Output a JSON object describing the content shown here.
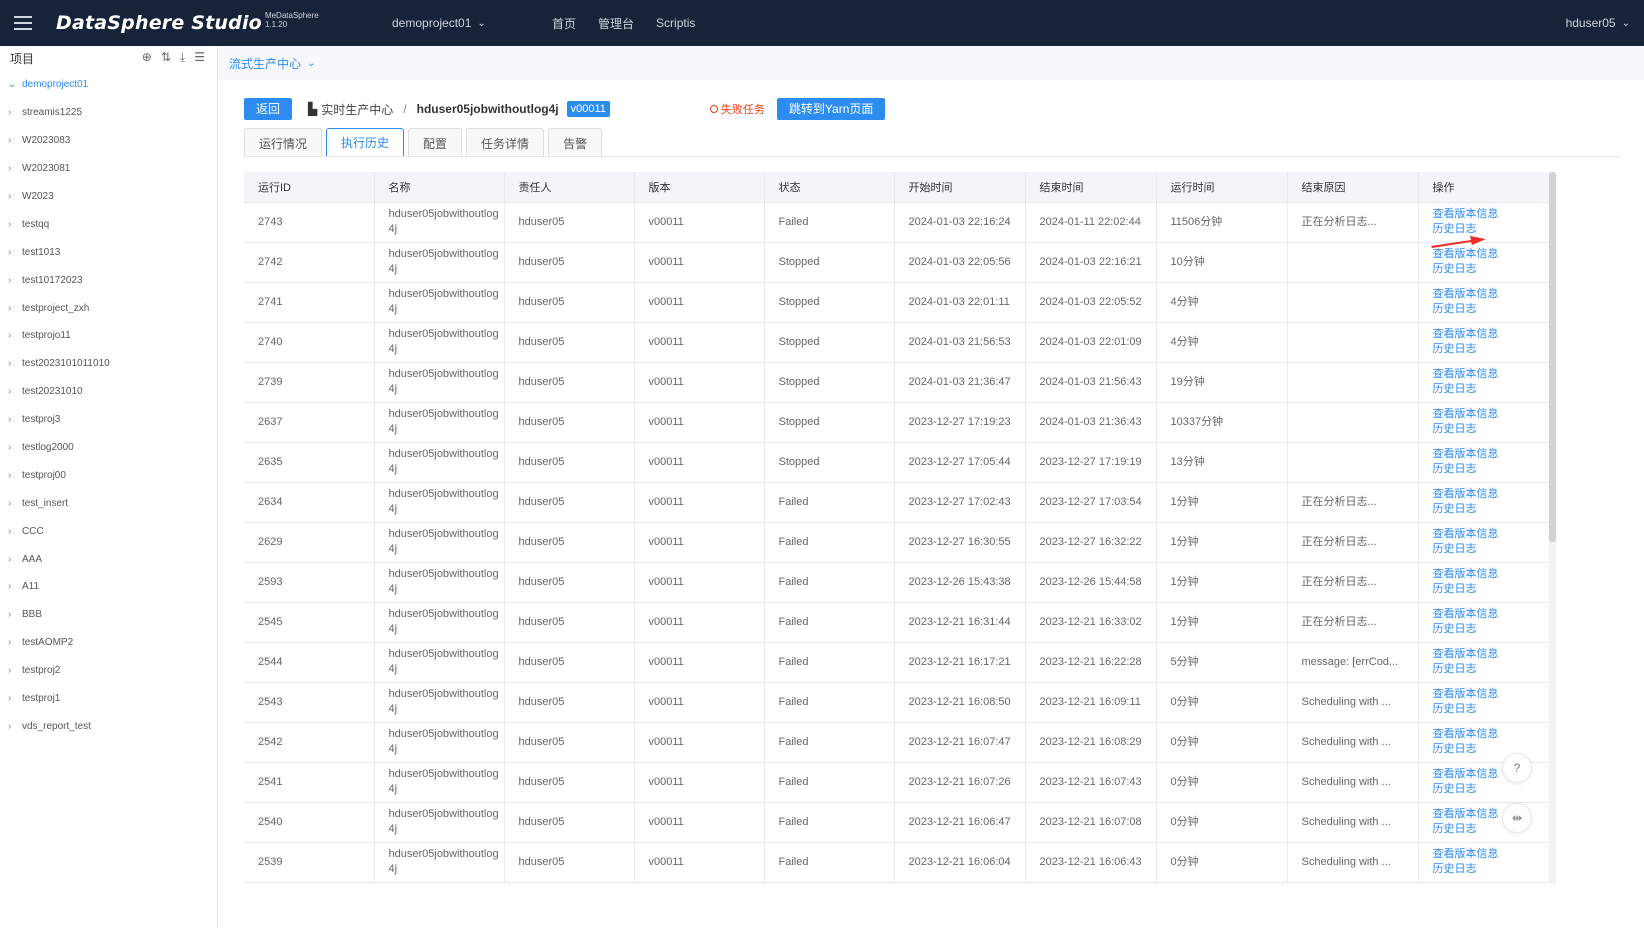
{
  "header": {
    "brand": "DataSphere Studio",
    "brand_sub_name": "MeDataSphere",
    "brand_version": "1.1.20",
    "project": "demoproject01",
    "nav": [
      "首页",
      "管理台",
      "Scriptis"
    ],
    "user": "hduser05"
  },
  "sidebar": {
    "title": "项目",
    "items": [
      {
        "label": "demoproject01",
        "active": true
      },
      {
        "label": "streamis1225"
      },
      {
        "label": "W2023083"
      },
      {
        "label": "W2023081"
      },
      {
        "label": "W2023"
      },
      {
        "label": "testqq"
      },
      {
        "label": "test1013"
      },
      {
        "label": "test10172023"
      },
      {
        "label": "testproject_zxh"
      },
      {
        "label": "testprojo11"
      },
      {
        "label": "test2023101011010"
      },
      {
        "label": "test20231010"
      },
      {
        "label": "testproj3"
      },
      {
        "label": "testlog2000"
      },
      {
        "label": "testproj00"
      },
      {
        "label": "test_insert"
      },
      {
        "label": "CCC"
      },
      {
        "label": "AAA"
      },
      {
        "label": "A11"
      },
      {
        "label": "BBB"
      },
      {
        "label": "testAOMP2"
      },
      {
        "label": "testproj2"
      },
      {
        "label": "testproj1"
      },
      {
        "label": "vds_report_test"
      }
    ]
  },
  "main": {
    "subheader": "流式生产中心",
    "back_button": "返回",
    "crumb_root": "实时生产中心",
    "job_name": "hduser05jobwithoutlog4j",
    "version": "v00011",
    "failed_task": "失败任务",
    "yarn_button": "跳转到Yarn页面",
    "tabs": [
      "运行情况",
      "执行历史",
      "配置",
      "任务详情",
      "告警"
    ],
    "active_tab": 1
  },
  "table": {
    "columns": [
      "运行ID",
      "名称",
      "责任人",
      "版本",
      "状态",
      "开始时间",
      "结束时间",
      "运行时间",
      "结束原因",
      "操作"
    ],
    "op_labels": [
      "查看版本信息",
      "历史日志"
    ],
    "rows": [
      {
        "id": "2743",
        "name": "hduser05jobwithoutlog4j",
        "owner": "hduser05",
        "version": "v00011",
        "status": "Failed",
        "start": "2024-01-03 22:16:24",
        "end": "2024-01-11 22:02:44",
        "duration": "11506分钟",
        "reason": "正在分析日志..."
      },
      {
        "id": "2742",
        "name": "hduser05jobwithoutlog4j",
        "owner": "hduser05",
        "version": "v00011",
        "status": "Stopped",
        "start": "2024-01-03 22:05:56",
        "end": "2024-01-03 22:16:21",
        "duration": "10分钟",
        "reason": ""
      },
      {
        "id": "2741",
        "name": "hduser05jobwithoutlog4j",
        "owner": "hduser05",
        "version": "v00011",
        "status": "Stopped",
        "start": "2024-01-03 22:01:11",
        "end": "2024-01-03 22:05:52",
        "duration": "4分钟",
        "reason": ""
      },
      {
        "id": "2740",
        "name": "hduser05jobwithoutlog4j",
        "owner": "hduser05",
        "version": "v00011",
        "status": "Stopped",
        "start": "2024-01-03 21:56:53",
        "end": "2024-01-03 22:01:09",
        "duration": "4分钟",
        "reason": ""
      },
      {
        "id": "2739",
        "name": "hduser05jobwithoutlog4j",
        "owner": "hduser05",
        "version": "v00011",
        "status": "Stopped",
        "start": "2024-01-03 21:36:47",
        "end": "2024-01-03 21:56:43",
        "duration": "19分钟",
        "reason": ""
      },
      {
        "id": "2637",
        "name": "hduser05jobwithoutlog4j",
        "owner": "hduser05",
        "version": "v00011",
        "status": "Stopped",
        "start": "2023-12-27 17:19:23",
        "end": "2024-01-03 21:36:43",
        "duration": "10337分钟",
        "reason": ""
      },
      {
        "id": "2635",
        "name": "hduser05jobwithoutlog4j",
        "owner": "hduser05",
        "version": "v00011",
        "status": "Stopped",
        "start": "2023-12-27 17:05:44",
        "end": "2023-12-27 17:19:19",
        "duration": "13分钟",
        "reason": ""
      },
      {
        "id": "2634",
        "name": "hduser05jobwithoutlog4j",
        "owner": "hduser05",
        "version": "v00011",
        "status": "Failed",
        "start": "2023-12-27 17:02:43",
        "end": "2023-12-27 17:03:54",
        "duration": "1分钟",
        "reason": "正在分析日志..."
      },
      {
        "id": "2629",
        "name": "hduser05jobwithoutlog4j",
        "owner": "hduser05",
        "version": "v00011",
        "status": "Failed",
        "start": "2023-12-27 16:30:55",
        "end": "2023-12-27 16:32:22",
        "duration": "1分钟",
        "reason": "正在分析日志..."
      },
      {
        "id": "2593",
        "name": "hduser05jobwithoutlog4j",
        "owner": "hduser05",
        "version": "v00011",
        "status": "Failed",
        "start": "2023-12-26 15:43:38",
        "end": "2023-12-26 15:44:58",
        "duration": "1分钟",
        "reason": "正在分析日志..."
      },
      {
        "id": "2545",
        "name": "hduser05jobwithoutlog4j",
        "owner": "hduser05",
        "version": "v00011",
        "status": "Failed",
        "start": "2023-12-21 16:31:44",
        "end": "2023-12-21 16:33:02",
        "duration": "1分钟",
        "reason": "正在分析日志..."
      },
      {
        "id": "2544",
        "name": "hduser05jobwithoutlog4j",
        "owner": "hduser05",
        "version": "v00011",
        "status": "Failed",
        "start": "2023-12-21 16:17:21",
        "end": "2023-12-21 16:22:28",
        "duration": "5分钟",
        "reason": "message: [errCod..."
      },
      {
        "id": "2543",
        "name": "hduser05jobwithoutlog4j",
        "owner": "hduser05",
        "version": "v00011",
        "status": "Failed",
        "start": "2023-12-21 16:08:50",
        "end": "2023-12-21 16:09:11",
        "duration": "0分钟",
        "reason": "Scheduling with ..."
      },
      {
        "id": "2542",
        "name": "hduser05jobwithoutlog4j",
        "owner": "hduser05",
        "version": "v00011",
        "status": "Failed",
        "start": "2023-12-21 16:07:47",
        "end": "2023-12-21 16:08:29",
        "duration": "0分钟",
        "reason": "Scheduling with ..."
      },
      {
        "id": "2541",
        "name": "hduser05jobwithoutlog4j",
        "owner": "hduser05",
        "version": "v00011",
        "status": "Failed",
        "start": "2023-12-21 16:07:26",
        "end": "2023-12-21 16:07:43",
        "duration": "0分钟",
        "reason": "Scheduling with ..."
      },
      {
        "id": "2540",
        "name": "hduser05jobwithoutlog4j",
        "owner": "hduser05",
        "version": "v00011",
        "status": "Failed",
        "start": "2023-12-21 16:06:47",
        "end": "2023-12-21 16:07:08",
        "duration": "0分钟",
        "reason": "Scheduling with ..."
      },
      {
        "id": "2539",
        "name": "hduser05jobwithoutlog4j",
        "owner": "hduser05",
        "version": "v00011",
        "status": "Failed",
        "start": "2023-12-21 16:06:04",
        "end": "2023-12-21 16:06:43",
        "duration": "0分钟",
        "reason": "Scheduling with ..."
      }
    ]
  },
  "colors": {
    "topbar": "#172339",
    "accent": "#2d8cf0",
    "failed": "#ed4014",
    "arrow": "#e8312a"
  }
}
